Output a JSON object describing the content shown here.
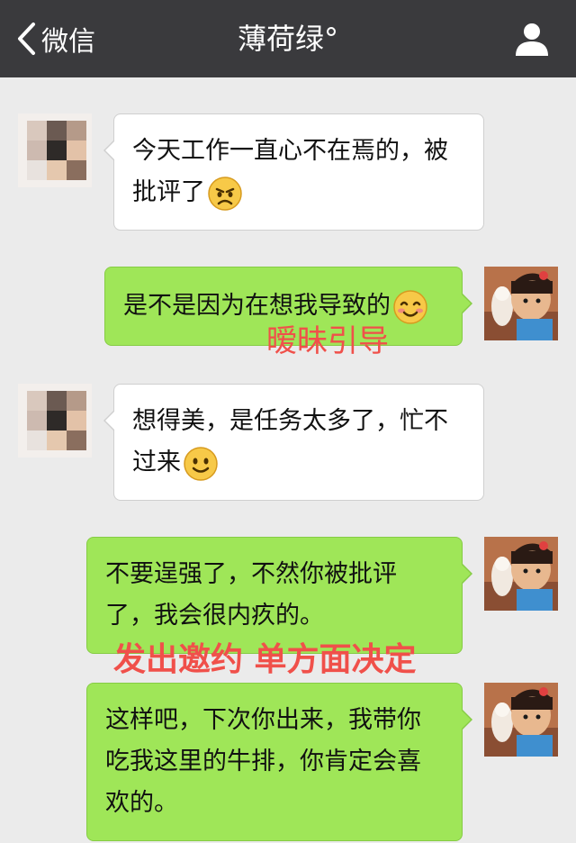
{
  "header": {
    "back_label": "微信",
    "title": "薄荷绿°",
    "back_icon": "chevron-left-icon",
    "profile_icon": "person-icon"
  },
  "messages": [
    {
      "sender": "contact",
      "text": "今天工作一直心不在焉的，被批评了",
      "emoji": "sad-face-emoji"
    },
    {
      "sender": "me",
      "text": "是不是因为在想我导致的",
      "emoji": "blushing-smile-emoji"
    },
    {
      "sender": "contact",
      "text": "想得美，是任务太多了，忙不过来",
      "emoji": "smile-emoji"
    },
    {
      "sender": "me",
      "text": "不要逞强了，不然你被批评了，我会很内疚的。"
    },
    {
      "sender": "me",
      "text": "这样吧，下次你出来，我带你吃我这里的牛排，你肯定会喜欢的。"
    }
  ],
  "annotations": {
    "first": "暧昧引导",
    "second": "发出邀约 单方面决定"
  },
  "colors": {
    "topbar": "#3a3a3d",
    "background": "#ebebeb",
    "outgoing_bubble": "#9fe658",
    "incoming_bubble": "#ffffff",
    "annotation": "#f0504a"
  }
}
